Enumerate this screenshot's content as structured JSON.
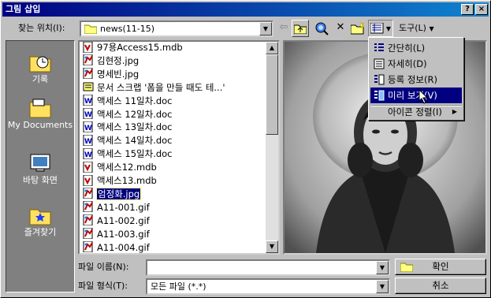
{
  "window": {
    "title": "그림 삽입",
    "help_label": "?",
    "close_label": "×"
  },
  "lookin": {
    "label": "찾는 위치(I):",
    "value": "news(11-15)"
  },
  "toolbar": {
    "tools_label": "도구(L)"
  },
  "places": [
    {
      "label": "기록"
    },
    {
      "label": "My Documents"
    },
    {
      "label": "바탕 화면"
    },
    {
      "label": "즐겨찾기"
    }
  ],
  "files": [
    {
      "name": "97용Access15.mdb",
      "type": "mdb"
    },
    {
      "name": "김현정.jpg",
      "type": "img"
    },
    {
      "name": "명세빈.jpg",
      "type": "img"
    },
    {
      "name": "문서 스크랩 '폼을 만들 때도 테...'",
      "type": "scrap"
    },
    {
      "name": "액세스 11일차.doc",
      "type": "doc"
    },
    {
      "name": "액세스 12일차.doc",
      "type": "doc"
    },
    {
      "name": "액세스 13일차.doc",
      "type": "doc"
    },
    {
      "name": "액세스 14일차.doc",
      "type": "doc"
    },
    {
      "name": "액세스 15일차.doc",
      "type": "doc"
    },
    {
      "name": "액세스12.mdb",
      "type": "mdb"
    },
    {
      "name": "액세스13.mdb",
      "type": "mdb"
    },
    {
      "name": "엄정화.jpg",
      "type": "img",
      "selected": true
    },
    {
      "name": "A11-001.gif",
      "type": "img"
    },
    {
      "name": "A11-002.gif",
      "type": "img"
    },
    {
      "name": "A11-003.gif",
      "type": "img"
    },
    {
      "name": "A11-004.gif",
      "type": "img"
    }
  ],
  "view_menu": [
    {
      "label": "간단히(L)"
    },
    {
      "label": "자세히(D)"
    },
    {
      "label": "등록 정보(R)"
    },
    {
      "label": "미리 보기(V)",
      "highlighted": true
    },
    {
      "label": "아이콘 정렬(I)"
    }
  ],
  "filename": {
    "label": "파일 이름(N):",
    "value": ""
  },
  "filetype": {
    "label": "파일 형식(T):",
    "value": "모든 파일 (*.*)"
  },
  "buttons": {
    "ok": "확인",
    "cancel": "취소"
  },
  "colors": {
    "title_start": "#000080",
    "title_end": "#1084d0",
    "selection": "#000080",
    "face": "#c0c0c0"
  }
}
